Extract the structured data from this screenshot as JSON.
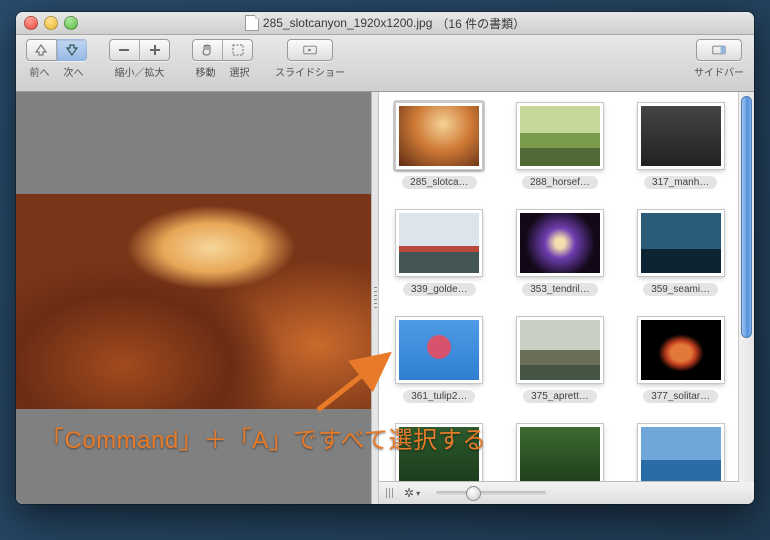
{
  "window": {
    "filename": "285_slotcanyon_1920x1200.jpg",
    "doc_count_text": "（16 件の書類）"
  },
  "toolbar": {
    "prev_label": "前へ",
    "next_label": "次へ",
    "zoom_label": "縮小／拡大",
    "move_label": "移動",
    "select_label": "選択",
    "slideshow_label": "スライドショー",
    "sidebar_label": "サイドバー"
  },
  "sidebar": {
    "thumbnails": [
      {
        "label": "285_slotca…",
        "css": "t0",
        "selected": true
      },
      {
        "label": "288_horsef…",
        "css": "t1",
        "selected": false
      },
      {
        "label": "317_manh…",
        "css": "t2",
        "selected": false
      },
      {
        "label": "339_golde…",
        "css": "t3",
        "selected": false
      },
      {
        "label": "353_tendril…",
        "css": "t4",
        "selected": false
      },
      {
        "label": "359_seami…",
        "css": "t5",
        "selected": false
      },
      {
        "label": "361_tulip2…",
        "css": "t6",
        "selected": false
      },
      {
        "label": "375_aprett…",
        "css": "t7",
        "selected": false
      },
      {
        "label": "377_solitar…",
        "css": "t8",
        "selected": false
      },
      {
        "label": "",
        "css": "t9",
        "selected": false
      },
      {
        "label": "",
        "css": "t10",
        "selected": false
      },
      {
        "label": "",
        "css": "t11",
        "selected": false
      }
    ]
  },
  "annotation": {
    "text": "「Command」＋「A」ですべて選択する"
  }
}
